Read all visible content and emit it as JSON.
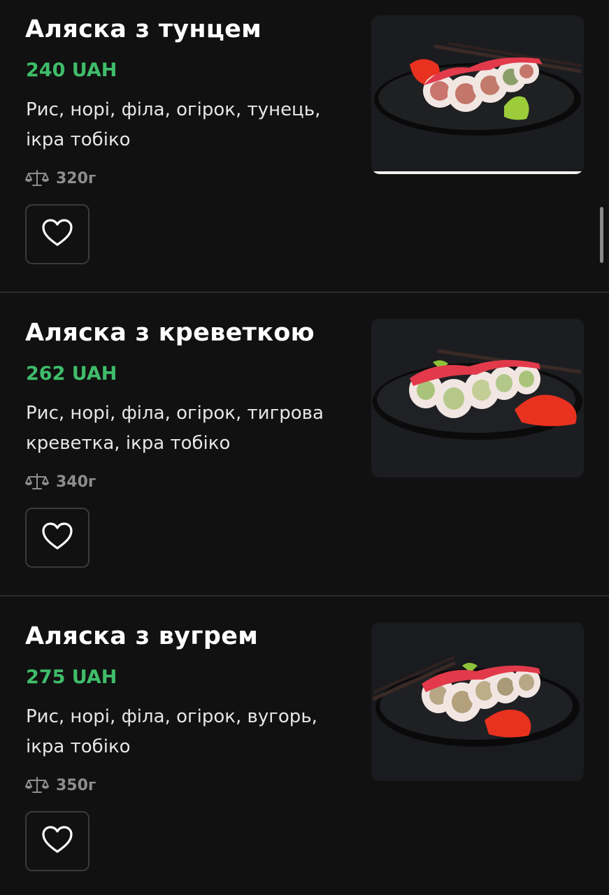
{
  "items": [
    {
      "title": "Аляска з тунцем",
      "price": "240 UAH",
      "description": "Рис, норі, філа, огірок, тунець, ікра тобіко",
      "weight": "320г"
    },
    {
      "title": "Аляска з креветкою",
      "price": "262 UAH",
      "description": "Рис, норі, філа, огірок, тигрова креветка, ікра тобіко",
      "weight": "340г"
    },
    {
      "title": "Аляска з вугрем",
      "price": "275 UAH",
      "description": "Рис, норі, філа, огірок, вугорь, ікра тобіко",
      "weight": "350г"
    }
  ],
  "icons": {
    "weight": "scales-icon",
    "favorite": "heart-icon"
  },
  "colors": {
    "background": "#111111",
    "price": "#3fbd6a",
    "weight_text": "#8e8e8e",
    "divider": "#2a2a2a"
  }
}
